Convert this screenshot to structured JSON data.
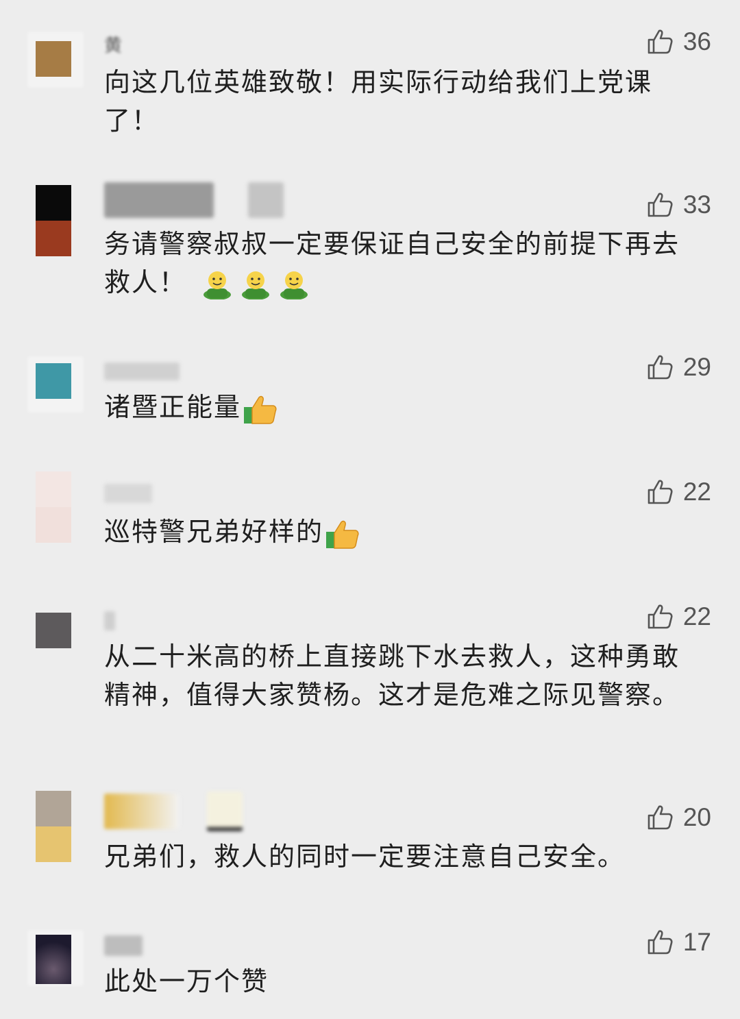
{
  "comments": [
    {
      "nickname": "黄",
      "likes": "36",
      "text": "向这几位英雄致敬！用实际行动给我们上党课了！",
      "avatar_colors": [
        "#a67c45",
        "#a67c45"
      ],
      "emoji": []
    },
    {
      "nickname": "",
      "likes": "33",
      "text": "务请警察叔叔一定要保证自己安全的前提下再去救人！",
      "avatar_colors": [
        "#0a0a0a",
        "#9a3a1f"
      ],
      "emoji": [
        "smiling-green-person-emoji",
        "smiling-green-person-emoji",
        "smiling-green-person-emoji"
      ]
    },
    {
      "nickname": "",
      "likes": "29",
      "text": "诸暨正能量",
      "avatar_colors": [
        "#3f98a6",
        "#3f98a6"
      ],
      "emoji": [
        "thumbs-up-emoji"
      ]
    },
    {
      "nickname": "",
      "likes": "22",
      "text": "巡特警兄弟好样的",
      "avatar_colors": [
        "#f3e6e3",
        "#f1e0dc"
      ],
      "emoji": [
        "thumbs-up-emoji"
      ]
    },
    {
      "nickname": "",
      "likes": "22",
      "text": "从二十米高的桥上直接跳下水去救人，这种勇敢精神，值得大家赞杨。这才是危难之际见警察。",
      "avatar_colors": [
        "#5d5a5c",
        "#5d5a5c"
      ],
      "emoji": []
    },
    {
      "nickname": "",
      "likes": "20",
      "text": "兄弟们，救人的同时一定要注意自己安全。",
      "avatar_colors": [
        "#b1a597",
        "#e6c470"
      ],
      "emoji": []
    },
    {
      "nickname": "",
      "likes": "17",
      "text": "此处一万个赞",
      "avatar_colors": [
        "#1d1a2e",
        "#2b2338"
      ],
      "emoji": []
    }
  ]
}
